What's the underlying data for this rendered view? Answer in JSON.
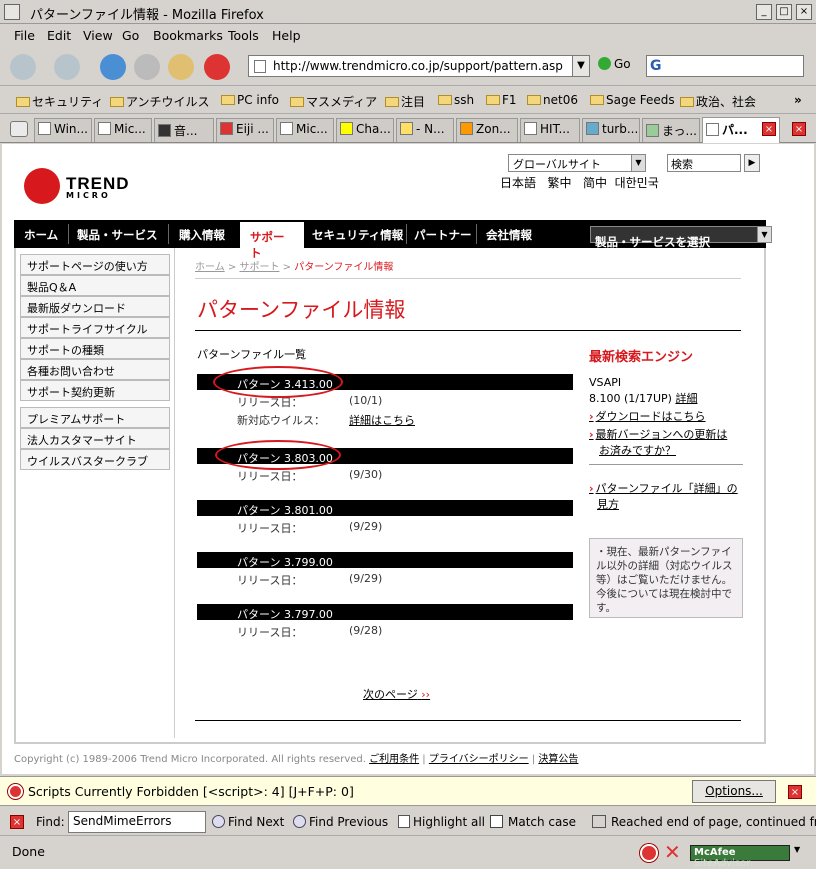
{
  "window": {
    "title": "パターンファイル情報 - Mozilla Firefox"
  },
  "menu": [
    "File",
    "Edit",
    "View",
    "Go",
    "Bookmarks",
    "Tools",
    "Help"
  ],
  "nav": {
    "url": "http://www.trendmicro.co.jp/support/pattern.asp",
    "go_label": "Go"
  },
  "bookmarks": [
    "セキュリティ",
    "アンチウイルス",
    "PC info",
    "マスメディア",
    "注目",
    "ssh",
    "F1",
    "net06",
    "Sage Feeds",
    "政治、社会"
  ],
  "tabs": [
    "Win...",
    "Mic...",
    "音...",
    "Eiji ...",
    "Mic...",
    "Cha...",
    "- N...",
    "Zon...",
    "HIT...",
    "turb...",
    "まっ...",
    "パ..."
  ],
  "site": {
    "logo_main": "TREND",
    "logo_sub": "MICRO",
    "global_site": "グローバルサイト",
    "search_label": "検索",
    "langs": [
      "日本語",
      "繁中",
      "简中",
      "대한민국"
    ],
    "gnav": [
      "ホーム",
      "製品・サービス",
      "購入情報",
      "サポート",
      "セキュリティ情報",
      "パートナー",
      "会社情報"
    ],
    "product_select": "製品・サービスを選択",
    "sidebar_group1": [
      "サポートページの使い方",
      "製品Q＆A",
      "最新版ダウンロード",
      "サポートライフサイクル",
      "サポートの種類",
      "各種お問い合わせ",
      "サポート契約更新"
    ],
    "sidebar_group2": [
      "プレミアムサポート",
      "法人カスタマーサイト",
      "ウイルスバスタークラブ"
    ],
    "breadcrumb": {
      "home": "ホーム",
      "support": "サポート",
      "current": "パターンファイル情報",
      "sep": " > "
    },
    "heading": "パターンファイル情報",
    "list_heading": "パターンファイル一覧",
    "release_label": "リリース日：",
    "virus_label": "新対応ウイルス：",
    "virus_link": "詳細はこちら",
    "patterns": [
      {
        "name": "パターン 3.413.00",
        "date": "(10/1)"
      },
      {
        "name": "パターン 3.803.00",
        "date": "(9/30)"
      },
      {
        "name": "パターン 3.801.00",
        "date": "(9/29)"
      },
      {
        "name": "パターン 3.799.00",
        "date": "(9/29)"
      },
      {
        "name": "パターン 3.797.00",
        "date": "(9/28)"
      }
    ],
    "next_page": "次のページ",
    "right": {
      "heading": "最新検索エンジン",
      "engine_name": "VSAPI",
      "engine_version": "8.100 (1/17UP)",
      "engine_detail": "詳細",
      "download_link": "ダウンロードはこちら",
      "update_link_1": "最新バージョンへの更新は",
      "update_link_2": "お済みですか？",
      "detail_link_1": "パターンファイル「詳細」の",
      "detail_link_2": "見方",
      "note": "・現在、最新パターンファイル以外の詳細（対応ウイルス等）はご覧いただけません。今後については現在検討中です。"
    },
    "footer": {
      "copyright": "Copyright (c) 1989-2006 Trend Micro Incorporated. All rights reserved.",
      "links": [
        "ご利用条件",
        "プライバシーポリシー",
        "決算公告"
      ]
    }
  },
  "scriptbar": {
    "text": "Scripts Currently Forbidden [<script>: 4] [J+F+P: 0]",
    "options": "Options..."
  },
  "find": {
    "label": "Find:",
    "value": "SendMimeErrors",
    "next": "Find Next",
    "previous": "Find Previous",
    "highlight": "Highlight all",
    "match_case": "Match case",
    "status": "Reached end of page, continued fro"
  },
  "status": {
    "text": "Done",
    "mcafee": "McAfee",
    "siteadvisor": "SiteAdvisor"
  }
}
